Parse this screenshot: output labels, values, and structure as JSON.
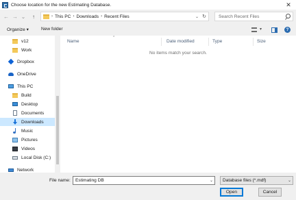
{
  "window": {
    "title": "Choose location for the new Estimating Database.",
    "close_glyph": "✕"
  },
  "nav_buttons": {
    "back": "←",
    "forward": "→",
    "recent": "⌄",
    "up": "↑"
  },
  "address": {
    "sep": "›",
    "crumbs": [
      "This PC",
      "Downloads",
      "Recent Files"
    ],
    "dropdown_glyph": "⌄",
    "refresh_glyph": "↻"
  },
  "search": {
    "placeholder": "Search Recent Files"
  },
  "toolbar": {
    "organize_label": "Organize ▾",
    "new_folder_label": "New folder",
    "view_dd_glyph": "▾",
    "help_glyph": "?"
  },
  "sidebar": {
    "items": [
      {
        "label": "v12",
        "icon": "folder-icon"
      },
      {
        "label": "Work",
        "icon": "folder-icon"
      },
      {
        "label": "Dropbox",
        "icon": "dropbox-icon"
      },
      {
        "label": "OneDrive",
        "icon": "cloud-icon"
      },
      {
        "label": "This PC",
        "icon": "computer-icon"
      },
      {
        "label": "Build",
        "icon": "folder-icon"
      },
      {
        "label": "Desktop",
        "icon": "desktop-icon"
      },
      {
        "label": "Documents",
        "icon": "documents-icon"
      },
      {
        "label": "Downloads",
        "icon": "download-arrow-icon",
        "selected": true
      },
      {
        "label": "Music",
        "icon": "music-note-icon"
      },
      {
        "label": "Pictures",
        "icon": "pictures-icon"
      },
      {
        "label": "Videos",
        "icon": "videos-icon"
      },
      {
        "label": "Local Disk (C:)",
        "icon": "disk-icon"
      },
      {
        "label": "Network",
        "icon": "network-icon"
      }
    ]
  },
  "file_list": {
    "columns": [
      "Name",
      "Date modified",
      "Type",
      "Size"
    ],
    "sort_glyph": "^",
    "empty_message": "No items match your search."
  },
  "footer": {
    "file_name_label": "File name:",
    "file_name_value": "Estimating DB",
    "file_type": "Database files (*.mdf)",
    "dropdown_glyph": "⌄",
    "open_label": "Open",
    "cancel_label": "Cancel"
  }
}
